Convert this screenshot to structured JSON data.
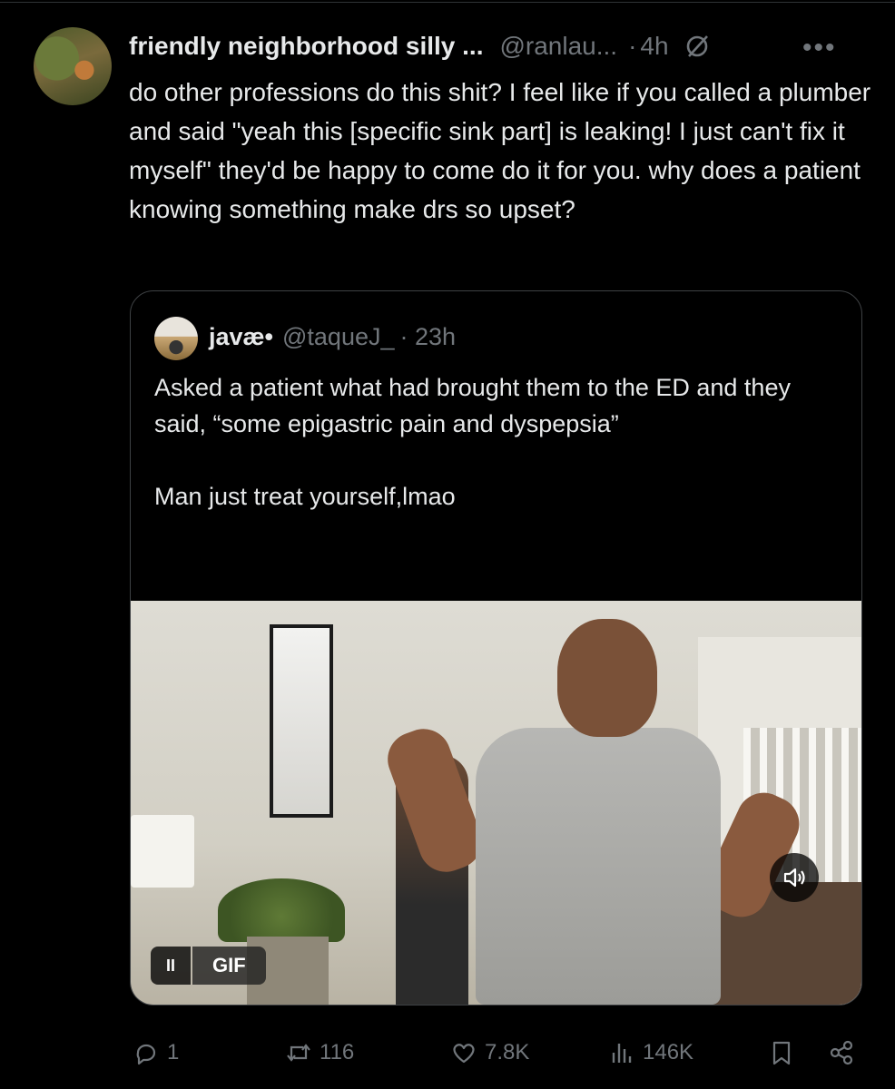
{
  "tweet": {
    "author_name": "friendly neighborhood silly ...",
    "author_handle": "@ranlau...",
    "separator": "·",
    "time": "4h",
    "text": "do other professions do this shit? I feel like if you called a plumber and said \"yeah this [specific sink part] is leaking! I just can't fix it myself\" they'd be happy to come do it for you. why does a patient knowing something make drs so upset?",
    "more_label": "•••"
  },
  "quoted": {
    "author_name": "javæ•",
    "author_handle": "@taqueJ_",
    "time": "· 23h",
    "text": "Asked a patient what had brought them to the ED and they said, “some epigastric pain and dyspepsia”\n\nMan just treat yourself,lmao",
    "media": {
      "type": "GIF",
      "pause_label": "II",
      "gif_label": "GIF"
    }
  },
  "actions": {
    "replies": "1",
    "reposts": "116",
    "likes": "7.8K",
    "views": "146K"
  },
  "colors": {
    "background": "#000000",
    "text": "#e7e9ea",
    "muted": "#71767b",
    "border": "#3e4144"
  },
  "icons": [
    "grok-icon",
    "more-icon",
    "reply-icon",
    "repost-icon",
    "like-icon",
    "views-icon",
    "bookmark-icon",
    "share-icon",
    "volume-icon",
    "pause-icon"
  ]
}
